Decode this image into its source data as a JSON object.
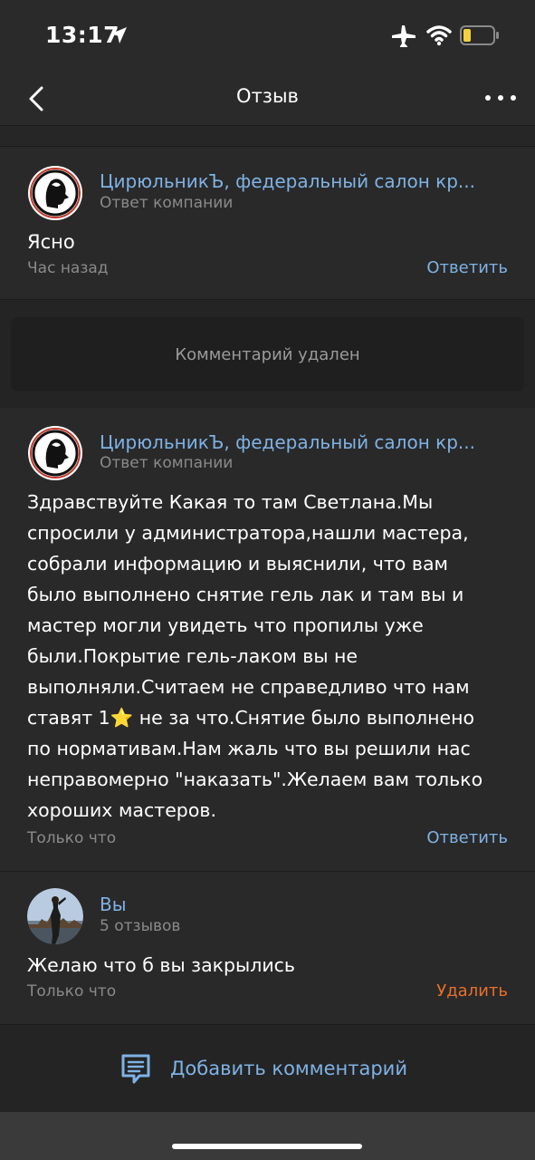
{
  "status_bar": {
    "time": "13:17",
    "battery_color": "#f4d03f"
  },
  "nav": {
    "title": "Отзыв",
    "back_icon": "chevron-left-icon",
    "more_icon": "ellipsis-icon"
  },
  "comments": [
    {
      "author": "ЦирюльникЪ, федеральный салон кр...",
      "subtitle": "Ответ компании",
      "text": "Ясно",
      "time": "Час назад",
      "action": "Ответить"
    },
    {
      "author": "ЦирюльникЪ, федеральный салон кр...",
      "subtitle": "Ответ компании",
      "text_lines": [
        "Здравствуйте Какая то там Светлана.Мы",
        "спросили у администратора,нашли мастера,",
        "собрали информацию и выяснили, что вам",
        "было выполнено снятие гель лак и там вы и",
        "мастер могли увидеть что пропилы уже",
        "были.Покрытие гель-лаком вы не",
        "выполняли.Считаем не справедливо что нам",
        "ставят 1⭐ не за что.Снятие было выполнено",
        "по нормативам.Нам жаль что вы решили нас",
        "неправомерно \"наказать\".Желаем вам только",
        "хороших мастеров."
      ],
      "time": "Только что",
      "action": "Ответить"
    },
    {
      "author": "Вы",
      "subtitle": "5 отзывов",
      "text": "Желаю что б вы закрылись",
      "time": "Только что",
      "action": "Удалить"
    }
  ],
  "deleted_notice": "Комментарий удален",
  "add_comment": {
    "label": "Добавить комментарий",
    "icon": "comment-icon"
  },
  "colors": {
    "link": "#7fb2e5",
    "delete": "#e8702a",
    "muted": "#8a8a8a"
  }
}
